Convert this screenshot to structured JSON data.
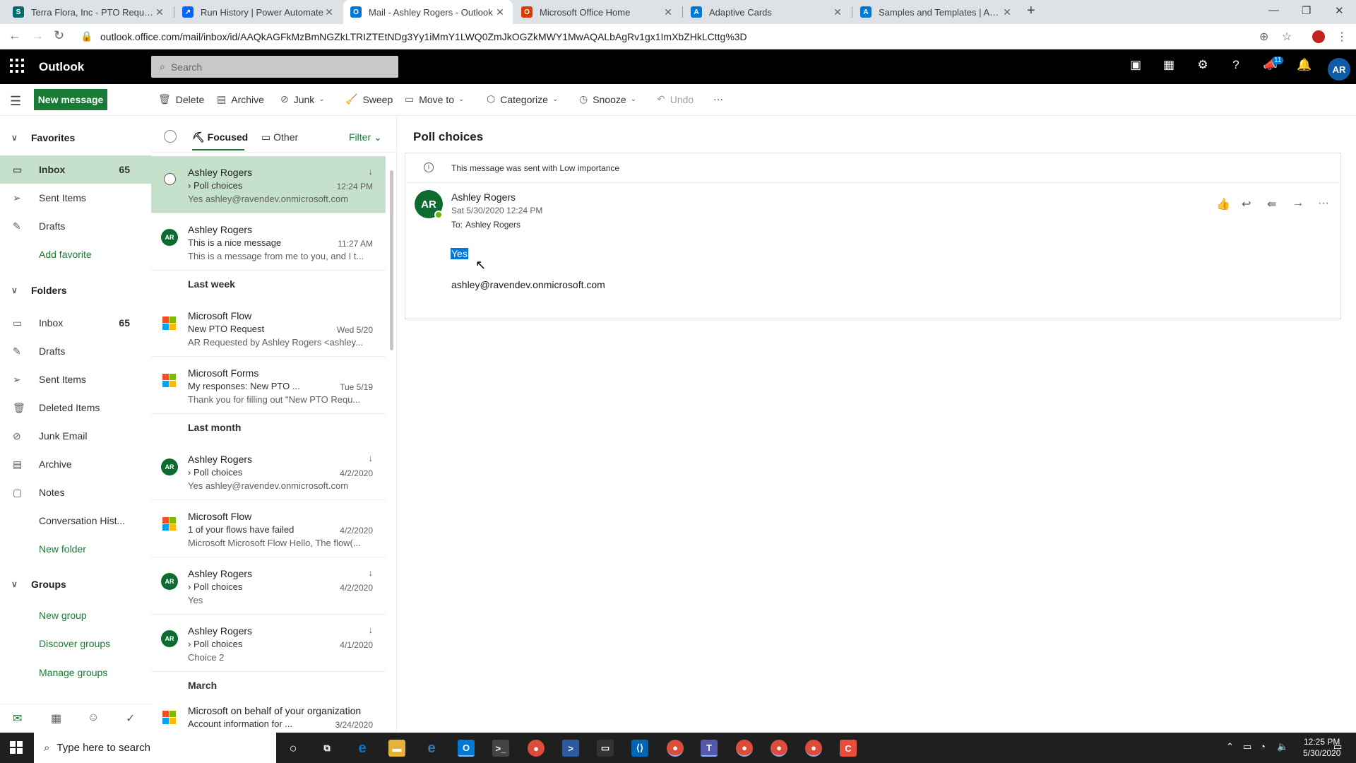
{
  "browser": {
    "tabs": [
      {
        "label": "Terra Flora, Inc - PTO Requests - ",
        "favicon": "sharepoint-icon",
        "color": "#036c70"
      },
      {
        "label": "Run History | Power Automate",
        "favicon": "power-automate-icon",
        "color": "#0066ff"
      },
      {
        "label": "Mail - Ashley Rogers - Outlook",
        "favicon": "outlook-icon",
        "color": "#0078d4",
        "active": true
      },
      {
        "label": "Microsoft Office Home",
        "favicon": "office-icon",
        "color": "#d83b01"
      },
      {
        "label": "Adaptive Cards",
        "favicon": "adaptive-cards-icon",
        "color": "#0078d4"
      },
      {
        "label": "Samples and Templates | Adaptiv",
        "favicon": "adaptive-cards-icon",
        "color": "#0078d4"
      }
    ],
    "url": "outlook.office.com/mail/inbox/id/AAQkAGFkMzBmNGZkLTRIZTEtNDg3Yy1iMmY1LWQ0ZmJkOGZkMWY1MwAQALbAgRv1gx1ImXbZHkLCttg%3D"
  },
  "header": {
    "brand": "Outlook",
    "search_placeholder": "Search",
    "notification_count": "11",
    "user_initials": "AR"
  },
  "toolbar": {
    "new_message": "New message",
    "delete": "Delete",
    "archive": "Archive",
    "junk": "Junk",
    "sweep": "Sweep",
    "move_to": "Move to",
    "categorize": "Categorize",
    "snooze": "Snooze",
    "undo": "Undo",
    "more": "···"
  },
  "nav": {
    "favorites": "Favorites",
    "fav_items": [
      {
        "label": "Inbox",
        "count": "65",
        "icon": "inbox-icon"
      },
      {
        "label": "Sent Items",
        "icon": "send-icon"
      },
      {
        "label": "Drafts",
        "icon": "pencil-icon"
      }
    ],
    "add_favorite": "Add favorite",
    "folders": "Folders",
    "folder_items": [
      {
        "label": "Inbox",
        "count": "65",
        "icon": "inbox-icon"
      },
      {
        "label": "Drafts",
        "icon": "pencil-icon"
      },
      {
        "label": "Sent Items",
        "icon": "send-icon"
      },
      {
        "label": "Deleted Items",
        "icon": "trash-icon"
      },
      {
        "label": "Junk Email",
        "icon": "junk-icon"
      },
      {
        "label": "Archive",
        "icon": "archive-icon"
      },
      {
        "label": "Notes",
        "icon": "notes-icon"
      },
      {
        "label": "Conversation Hist...",
        "icon": ""
      }
    ],
    "new_folder": "New folder",
    "groups": "Groups",
    "new_group": "New group",
    "discover_groups": "Discover groups",
    "manage_groups": "Manage groups"
  },
  "list": {
    "focused": "Focused",
    "other": "Other",
    "filter": "Filter",
    "group_last_week": "Last week",
    "group_last_month": "Last month",
    "group_march": "March",
    "messages": [
      {
        "sender": "Ashley Rogers",
        "subject": "Poll choices",
        "preview": "Yes ashley@ravendev.onmicrosoft.com",
        "date": "12:24 PM"
      },
      {
        "sender": "Ashley Rogers",
        "subject": "This is a nice message",
        "preview": "This is a message from me to you, and I t...",
        "date": "11:27 AM",
        "initials": "AR"
      },
      {
        "sender": "Microsoft Flow",
        "subject": "New PTO Request",
        "preview": "AR Requested by Ashley Rogers <ashley...",
        "date": "Wed 5/20"
      },
      {
        "sender": "Microsoft Forms",
        "subject": "My responses: New PTO ...",
        "preview": "Thank you for filling out \"New PTO Requ...",
        "date": "Tue 5/19"
      },
      {
        "sender": "Ashley Rogers",
        "subject": "Poll choices",
        "preview": "Yes ashley@ravendev.onmicrosoft.com",
        "date": "4/2/2020",
        "initials": "AR"
      },
      {
        "sender": "Microsoft Flow",
        "subject": "1 of your flows have failed",
        "preview": "Microsoft Microsoft Flow Hello, The flow(...",
        "date": "4/2/2020"
      },
      {
        "sender": "Ashley Rogers",
        "subject": "Poll choices",
        "preview": "Yes",
        "date": "4/2/2020",
        "initials": "AR"
      },
      {
        "sender": "Ashley Rogers",
        "subject": "Poll choices",
        "preview": "Choice 2",
        "date": "4/1/2020",
        "initials": "AR"
      },
      {
        "sender": "Microsoft on behalf of your organization",
        "subject": "Account information for ...",
        "date": "3/24/2020"
      }
    ]
  },
  "reading": {
    "title": "Poll choices",
    "info": "This message was sent with Low importance",
    "initials": "AR",
    "sender": "Ashley Rogers",
    "date": "Sat 5/30/2020 12:24 PM",
    "to_label": "To:",
    "to": "Ashley Rogers",
    "body_line1": "Yes",
    "body_line2": "ashley@ravendev.onmicrosoft.com"
  },
  "taskbar": {
    "search_placeholder": "Type here to search",
    "time": "12:25 PM",
    "date": "5/30/2020"
  }
}
